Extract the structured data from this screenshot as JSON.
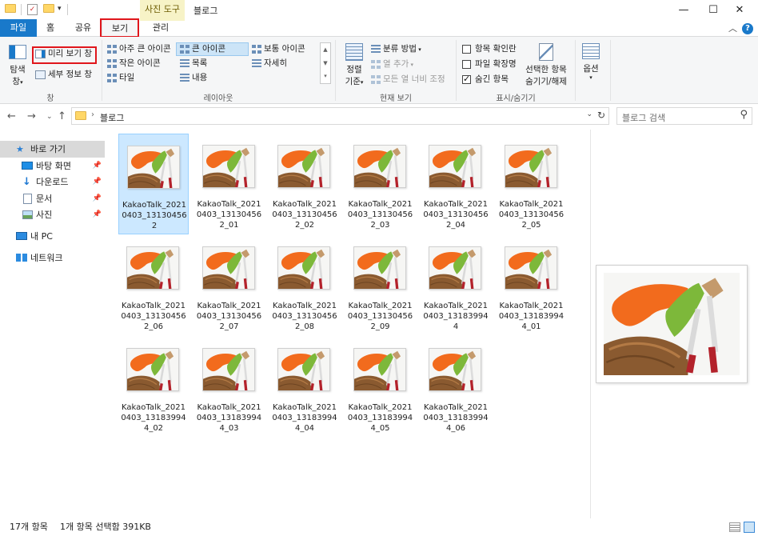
{
  "window": {
    "title": "블로그",
    "context_tab_group": "사진 도구",
    "controls": {
      "minimize": "—",
      "maximize": "☐",
      "close": "✕"
    }
  },
  "ribbon_tabs": {
    "file": "파일",
    "home": "홈",
    "share": "공유",
    "view": "보기",
    "manage": "관리",
    "collapse": "︿",
    "help": "?"
  },
  "ribbon": {
    "panes": {
      "nav_pane": [
        "탐색",
        "창"
      ],
      "preview_pane": "미리 보기 창",
      "details_pane": "세부 정보 창",
      "group_label": "창"
    },
    "layout": {
      "items": [
        "아주 큰 아이콘",
        "큰 아이콘",
        "보통 아이콘",
        "작은 아이콘",
        "목록",
        "자세히",
        "타일",
        "내용"
      ],
      "group_label": "레이아웃"
    },
    "current_view": {
      "sort_by": [
        "정렬",
        "기준"
      ],
      "group_by": "분류 방법",
      "add_columns": "열 추가",
      "size_columns": "모든 열 너비 조정",
      "group_label": "현재 보기"
    },
    "show_hide": {
      "item_checkboxes": "항목 확인란",
      "file_extensions": "파일 확장명",
      "hidden_items": "숨긴 항목",
      "hide_selected": [
        "선택한 항목",
        "숨기기/해제"
      ],
      "group_label": "표시/숨기기"
    },
    "options": "옵션"
  },
  "address": {
    "path": "블로그",
    "search_placeholder": "블로그 검색"
  },
  "nav_pane": {
    "quick_access": "바로 가기",
    "desktop": "바탕 화면",
    "downloads": "다운로드",
    "documents": "문서",
    "pictures": "사진",
    "this_pc": "내 PC",
    "network": "네트워크"
  },
  "files": [
    {
      "l1": "KakaoTalk_2021",
      "l2": "0403_13130456",
      "l3": "2"
    },
    {
      "l1": "KakaoTalk_2021",
      "l2": "0403_13130456",
      "l3": "2_01"
    },
    {
      "l1": "KakaoTalk_2021",
      "l2": "0403_13130456",
      "l3": "2_02"
    },
    {
      "l1": "KakaoTalk_2021",
      "l2": "0403_13130456",
      "l3": "2_03"
    },
    {
      "l1": "KakaoTalk_2021",
      "l2": "0403_13130456",
      "l3": "2_04"
    },
    {
      "l1": "KakaoTalk_2021",
      "l2": "0403_13130456",
      "l3": "2_05"
    },
    {
      "l1": "KakaoTalk_2021",
      "l2": "0403_13130456",
      "l3": "2_06"
    },
    {
      "l1": "KakaoTalk_2021",
      "l2": "0403_13130456",
      "l3": "2_07"
    },
    {
      "l1": "KakaoTalk_2021",
      "l2": "0403_13130456",
      "l3": "2_08"
    },
    {
      "l1": "KakaoTalk_2021",
      "l2": "0403_13130456",
      "l3": "2_09"
    },
    {
      "l1": "KakaoTalk_2021",
      "l2": "0403_13183994",
      "l3": "4"
    },
    {
      "l1": "KakaoTalk_2021",
      "l2": "0403_13183994",
      "l3": "4_01"
    },
    {
      "l1": "KakaoTalk_2021",
      "l2": "0403_13183994",
      "l3": "4_02"
    },
    {
      "l1": "KakaoTalk_2021",
      "l2": "0403_13183994",
      "l3": "4_03"
    },
    {
      "l1": "KakaoTalk_2021",
      "l2": "0403_13183994",
      "l3": "4_04"
    },
    {
      "l1": "KakaoTalk_2021",
      "l2": "0403_13183994",
      "l3": "4_05"
    },
    {
      "l1": "KakaoTalk_2021",
      "l2": "0403_13183994",
      "l3": "4_06"
    }
  ],
  "status": {
    "item_count": "17개 항목",
    "selection": "1개 항목 선택함 391KB"
  },
  "colors": {
    "accent": "#1979ca",
    "highlight_box": "#e0161c",
    "selection": "#cce8ff"
  }
}
